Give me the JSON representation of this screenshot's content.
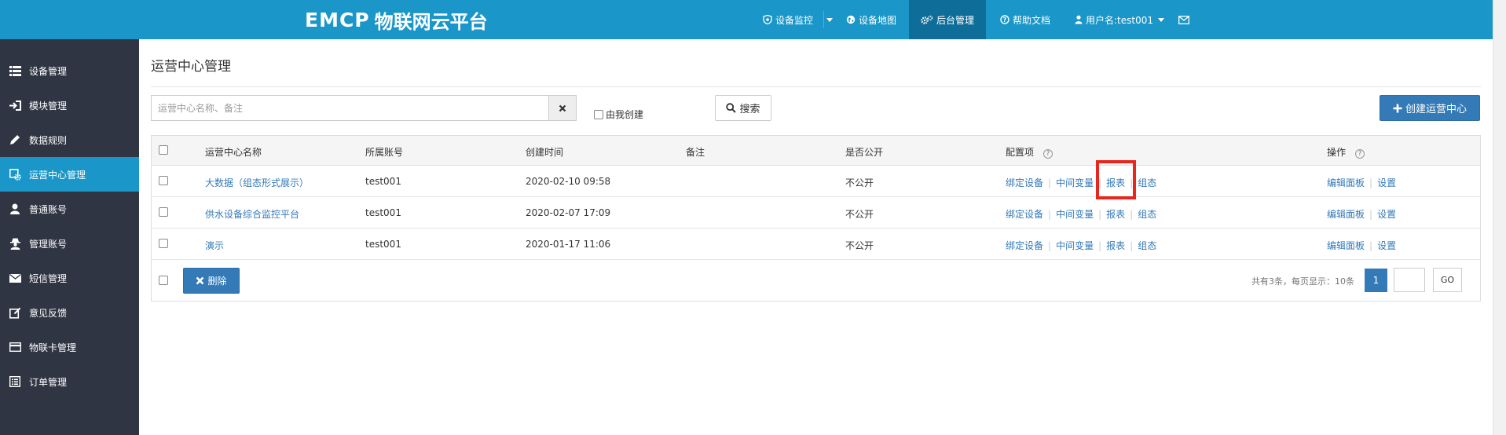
{
  "colors": {
    "brand": "#1a96c8",
    "nav_active": "#0e6e99",
    "sidebar": "#2f3542",
    "primary": "#337ab7",
    "highlight": "#e8261d"
  },
  "header": {
    "logo_mark": "EMCP",
    "logo_text": "物联网云平台",
    "nav": [
      {
        "label": "设备监控",
        "icon": "shield-icon",
        "dropdown": true
      },
      {
        "label": "设备地图",
        "icon": "globe-icon"
      },
      {
        "label": "后台管理",
        "icon": "gears-icon",
        "active": true
      },
      {
        "label": "帮助文档",
        "icon": "question-circle-icon"
      },
      {
        "label": "用户名:test001",
        "icon": "user-icon",
        "dropdown": true
      },
      {
        "label": "",
        "icon": "envelope-icon"
      }
    ]
  },
  "sidebar": {
    "items": [
      {
        "label": "设备管理",
        "icon": "list-icon"
      },
      {
        "label": "模块管理",
        "icon": "sign-in-icon"
      },
      {
        "label": "数据规则",
        "icon": "pencil-icon"
      },
      {
        "label": "运营中心管理",
        "icon": "gear-square-icon",
        "active": true
      },
      {
        "label": "普通账号",
        "icon": "user-icon"
      },
      {
        "label": "管理账号",
        "icon": "user-secret-icon"
      },
      {
        "label": "短信管理",
        "icon": "envelope-icon"
      },
      {
        "label": "意见反馈",
        "icon": "edit-icon"
      },
      {
        "label": "物联卡管理",
        "icon": "credit-card-icon"
      },
      {
        "label": "订单管理",
        "icon": "list-alt-icon"
      }
    ]
  },
  "main": {
    "title": "运营中心管理",
    "search": {
      "placeholder": "运营中心名称、备注",
      "value": ""
    },
    "mine_label": "由我创建",
    "search_label": "搜索",
    "create_label": "创建运营中心",
    "table": {
      "headers": [
        "运营中心名称",
        "所属账号",
        "创建时间",
        "备注",
        "是否公开",
        "配置项",
        "操作"
      ],
      "config_links": [
        "绑定设备",
        "中间变量",
        "报表",
        "组态"
      ],
      "action_links": [
        "编辑面板",
        "设置"
      ],
      "rows": [
        {
          "name": "大数据（组态形式展示）",
          "account": "test001",
          "created": "2020-02-10 09:58",
          "note": "",
          "public": "不公开"
        },
        {
          "name": "供水设备综合监控平台",
          "account": "test001",
          "created": "2020-02-07 17:09",
          "note": "",
          "public": "不公开"
        },
        {
          "name": "演示",
          "account": "test001",
          "created": "2020-01-17 11:06",
          "note": "",
          "public": "不公开"
        }
      ]
    },
    "delete_label": "删除",
    "pager": {
      "info": "共有3条，每页显示：10条",
      "current": "1",
      "go_label": "GO"
    }
  }
}
